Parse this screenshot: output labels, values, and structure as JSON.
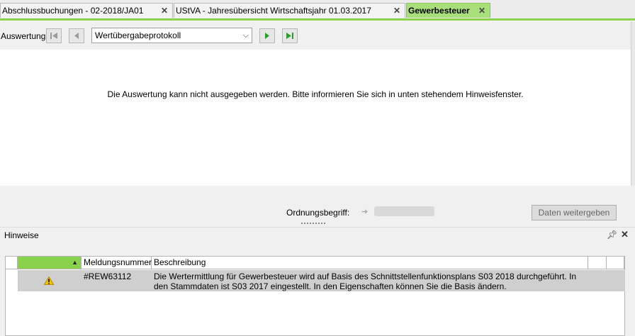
{
  "tabs": [
    {
      "label": "Abschlussbuchungen  - 02-2018/JA01",
      "active": false
    },
    {
      "label": "UStVA -  Jahresübersicht Wirtschaftsjahr 01.03.2017",
      "active": false
    },
    {
      "label": "Gewerbesteuer",
      "active": true
    }
  ],
  "toolbar": {
    "auswertung_label": "Auswertung:",
    "selected_report": "Wertübergabeprotokoll"
  },
  "output": {
    "message": "Die Auswertung kann nicht ausgegeben werden. Bitte informieren Sie sich in unten stehendem Hinweisfenster."
  },
  "footer": {
    "ordnungsbegriff_label": "Ordnungsbegriff:",
    "daten_button": "Daten weitergeben"
  },
  "hinweise": {
    "title": "Hinweise",
    "columns": [
      "",
      "Meldungsnummer",
      "Beschreibung"
    ],
    "rows": [
      {
        "icon": "warning-icon",
        "number": "#REW63112",
        "description": "Die Wertermittlung für Gewerbesteuer wird auf Basis des Schnittstellenfunktionsplans S03 2018 durchgeführt. In den Stammdaten ist S03 2017 eingestellt. In den Eigenschaften können Sie die Basis ändern."
      }
    ]
  },
  "colors": {
    "accent": "#8bd24c",
    "active_tab": "#a8df7a",
    "selected_row": "#cfcfcf"
  }
}
